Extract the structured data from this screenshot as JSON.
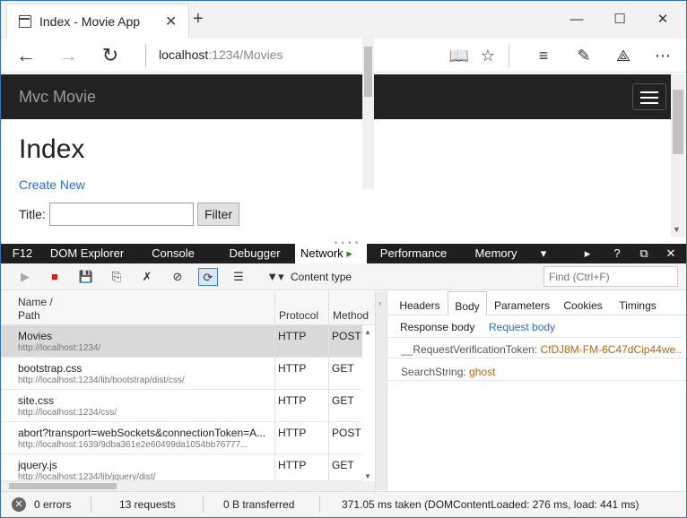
{
  "browser": {
    "tab_title": "Index - Movie App",
    "url_host": "localhost",
    "url_path": ":1234/Movies"
  },
  "page": {
    "brand": "Mvc Movie",
    "heading": "Index",
    "create_link": "Create New",
    "title_label": "Title:",
    "title_value": "",
    "filter_button": "Filter"
  },
  "devtools": {
    "tabs": [
      "F12",
      "DOM Explorer",
      "Console",
      "Debugger",
      "Network",
      "Performance",
      "Memory"
    ],
    "active_tab": "Network",
    "toolbar": {
      "content_type_label": "Content type",
      "find_placeholder": "Find (Ctrl+F)"
    },
    "columns": {
      "name": "Name /",
      "path": "Path",
      "protocol": "Protocol",
      "method": "Method"
    },
    "requests": [
      {
        "name": "Movies",
        "path": "http://localhost:1234/",
        "protocol": "HTTP",
        "method": "POST"
      },
      {
        "name": "bootstrap.css",
        "path": "http://localhost:1234/lib/bootstrap/dist/css/",
        "protocol": "HTTP",
        "method": "GET"
      },
      {
        "name": "site.css",
        "path": "http://localhost:1234/css/",
        "protocol": "HTTP",
        "method": "GET"
      },
      {
        "name": "abort?transport=webSockets&connectionToken=A...",
        "path": "http://localhost:1639/9dba361e2e60499da1054bb76777...",
        "protocol": "HTTP",
        "method": "POST"
      },
      {
        "name": "jquery.js",
        "path": "http://localhost:1234/lib/jquery/dist/",
        "protocol": "HTTP",
        "method": "GET"
      }
    ],
    "detail_tabs": [
      "Headers",
      "Body",
      "Parameters",
      "Cookies",
      "Timings"
    ],
    "active_detail_tab": "Body",
    "body_subtabs": [
      "Response body",
      "Request body"
    ],
    "active_body_subtab": "Request body",
    "request_body": [
      {
        "key": "__RequestVerificationToken:",
        "value": "CfDJ8M-FM-6C47dCip44we..."
      },
      {
        "key": "SearchString:",
        "value": "ghost"
      }
    ]
  },
  "status": {
    "errors": "0 errors",
    "requests": "13 requests",
    "transferred": "0 B transferred",
    "timing": "371.05 ms taken (DOMContentLoaded: 276 ms, load: 441 ms)"
  },
  "colors": {
    "navbar": "#222222",
    "link": "#2a6cc6",
    "value": "#b4660e",
    "devtools_tabs_bg": "#1f1f1f"
  }
}
